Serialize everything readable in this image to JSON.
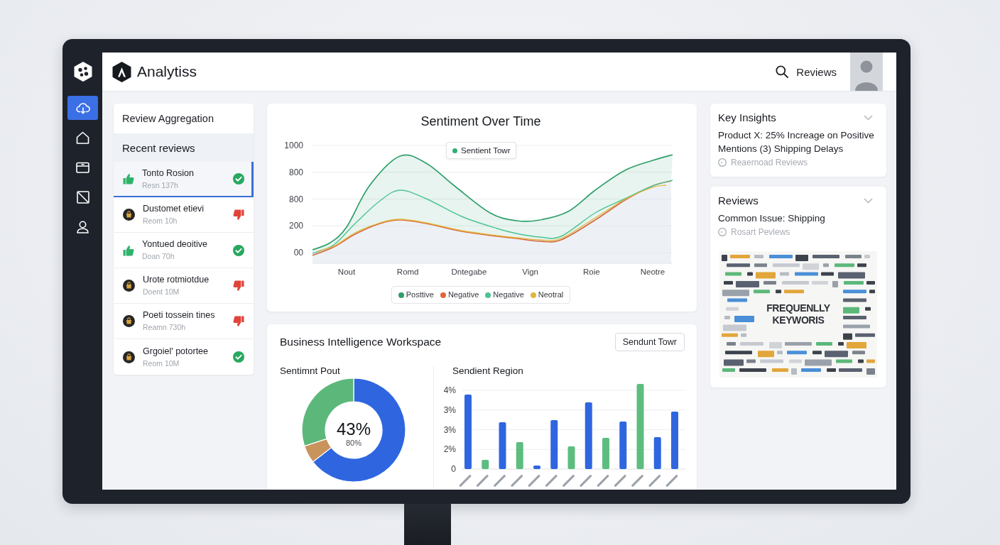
{
  "sidebar": {
    "items": [
      {
        "selected": true
      },
      {
        "selected": false
      },
      {
        "selected": false
      },
      {
        "selected": false
      },
      {
        "selected": false
      }
    ]
  },
  "header": {
    "brand": "Analytiss",
    "search_label": "Reviews"
  },
  "review_panel": {
    "title": "Review Aggregation",
    "section_title": "Recent reviews",
    "reviews": [
      {
        "title": "Tonto Rosion",
        "meta": "Resn 137h",
        "kind": "thumbs-up",
        "positive": true,
        "selected": true
      },
      {
        "title": "Dustomet etievi",
        "meta": "Reom 10h",
        "kind": "badge",
        "positive": false,
        "selected": false
      },
      {
        "title": "Yontued deoitive",
        "meta": "Doan 70h",
        "kind": "thumbs-up",
        "positive": true,
        "selected": false
      },
      {
        "title": "Urote rotmiotdue",
        "meta": "Doent 10M",
        "kind": "badge",
        "positive": false,
        "selected": false
      },
      {
        "title": "Poeti tossein tines",
        "meta": "Reamn 730h",
        "kind": "badge",
        "positive": false,
        "selected": false
      },
      {
        "title": "Grgoiel' potortee",
        "meta": "Reom 10M",
        "kind": "badge",
        "positive": true,
        "selected": false
      }
    ]
  },
  "sentiment_chart": {
    "title": "Sentiment Over Time",
    "tooltip": "Sentient Towr",
    "y_labels": [
      "1000",
      "800",
      "800",
      "200",
      "00"
    ],
    "x_labels": [
      "Nout",
      "Romd",
      "Dntegabe",
      "Vign",
      "Roie",
      "Neotre"
    ],
    "legend": [
      {
        "label": "Posttive",
        "color": "#2e9f6a"
      },
      {
        "label": "Negative",
        "color": "#e0663a"
      },
      {
        "label": "Negative",
        "color": "#4cc393"
      },
      {
        "label": "Neotral",
        "color": "#e3b53c"
      }
    ]
  },
  "workspace": {
    "title": "Business Intelligence Workspace",
    "button": "Sendunt Towr",
    "donut_panel": {
      "title": "Sentimnt Pout",
      "center_value": "43%",
      "center_caption": "80%"
    },
    "bar_panel": {
      "title": "Sendient Region",
      "y_labels": [
        "4%",
        "3%",
        "3%",
        "2%",
        "0"
      ]
    }
  },
  "insights": {
    "title": "Key Insights",
    "text": "Product X: 25% Increage on Positive Mentions (3) Shipping Delays",
    "source": "Reaernoad Reviews"
  },
  "reviews_card": {
    "title": "Reviews",
    "text": "Common Issue: Shipping",
    "source": "Rosart Pevlews",
    "word_cloud": {
      "headline": "FREQUENLLY KEYWORIS"
    }
  }
}
